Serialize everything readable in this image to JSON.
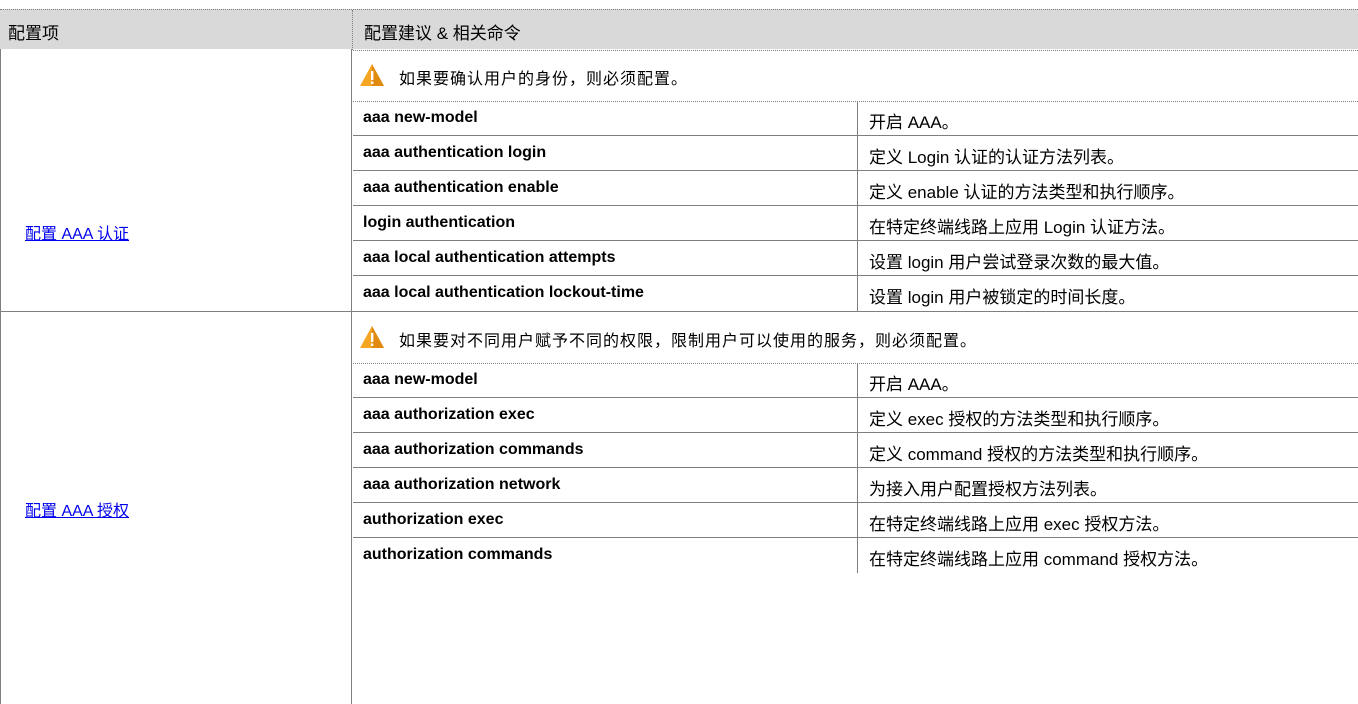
{
  "header": {
    "col1": "配置项",
    "col2": "配置建议 & 相关命令"
  },
  "sections": [
    {
      "link": "配置 AAA 认证",
      "caution": "如果要确认用户的身份，则必须配置。",
      "rows": [
        {
          "cmd": "aaa new-model",
          "desc": "开启 AAA。"
        },
        {
          "cmd": "aaa authentication login",
          "desc": "定义 Login 认证的认证方法列表。"
        },
        {
          "cmd": "aaa authentication enable",
          "desc": "定义 enable 认证的方法类型和执行顺序。"
        },
        {
          "cmd": "login authentication",
          "desc": "在特定终端线路上应用 Login 认证方法。"
        },
        {
          "cmd": "aaa local authentication attempts",
          "desc": "设置 login 用户尝试登录次数的最大值。"
        },
        {
          "cmd": "aaa local authentication lockout-time",
          "desc": "设置 login 用户被锁定的时间长度。"
        }
      ]
    },
    {
      "link": "配置 AAA 授权",
      "caution": "如果要对不同用户赋予不同的权限，限制用户可以使用的服务，则必须配置。",
      "rows": [
        {
          "cmd": "aaa new-model",
          "desc": "开启 AAA。"
        },
        {
          "cmd": "aaa authorization exec",
          "desc": "定义 exec 授权的方法类型和执行顺序。"
        },
        {
          "cmd": "aaa authorization commands",
          "desc": "定义 command 授权的方法类型和执行顺序。"
        },
        {
          "cmd": "aaa authorization network",
          "desc": "为接入用户配置授权方法列表。"
        },
        {
          "cmd": "authorization exec",
          "desc": "在特定终端线路上应用 exec 授权方法。"
        },
        {
          "cmd": "authorization commands",
          "desc": "在特定终端线路上应用 command 授权方法。"
        }
      ]
    }
  ],
  "colors": {
    "header_bg": "#d9d9d9",
    "border": "#7f7f7f",
    "link": "#0000ee",
    "warning": "#f5a623"
  },
  "icons": {
    "caution": "warning-triangle-icon"
  }
}
